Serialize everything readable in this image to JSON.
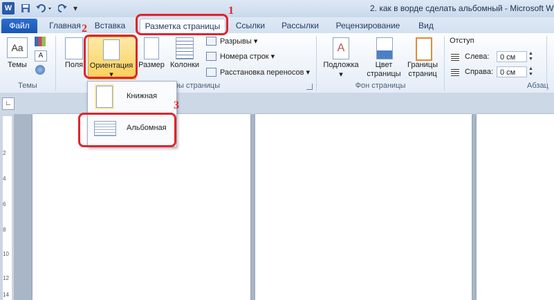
{
  "window": {
    "title": "2. как в ворде сделать альбомный  -  Microsoft W",
    "app_icon": "W",
    "quick_access": [
      "save-icon",
      "undo-icon",
      "redo-icon"
    ]
  },
  "tabs": [
    {
      "label": "Файл"
    },
    {
      "label": "Главная"
    },
    {
      "label": "Вставка"
    },
    {
      "label": "Разметка страницы",
      "active": true
    },
    {
      "label": "Ссылки"
    },
    {
      "label": "Рассылки"
    },
    {
      "label": "Рецензирование"
    },
    {
      "label": "Вид"
    }
  ],
  "ribbon": {
    "themes": {
      "button": "Темы",
      "group": "Темы"
    },
    "page_setup": {
      "fields": "Поля",
      "orientation": "Ориентация",
      "size": "Размер",
      "columns": "Колонки",
      "breaks": "Разрывы",
      "line_numbers": "Номера строк",
      "hyphenation": "Расстановка переносов",
      "group": "ры страницы"
    },
    "background": {
      "watermark": "Подложка",
      "page_color_1": "Цвет",
      "page_color_2": "страницы",
      "borders_1": "Границы",
      "borders_2": "страниц",
      "group": "Фон страницы"
    },
    "paragraph": {
      "indent": "Отступ",
      "left_label": "Слева:",
      "left_value": "0 см",
      "right_label": "Справа:",
      "right_value": "0 см",
      "group": "Абзац"
    }
  },
  "orientation_menu": {
    "portrait": "Книжная",
    "landscape": "Альбомная"
  },
  "annotations": [
    "1",
    "2",
    "3"
  ],
  "ruler_numbers": [
    "2",
    "4",
    "6",
    "8",
    "10",
    "12",
    "14"
  ],
  "colors": {
    "annotation": "#e0242c",
    "file_tab": "#2b6ed0",
    "highlight": "#fbcf59"
  }
}
